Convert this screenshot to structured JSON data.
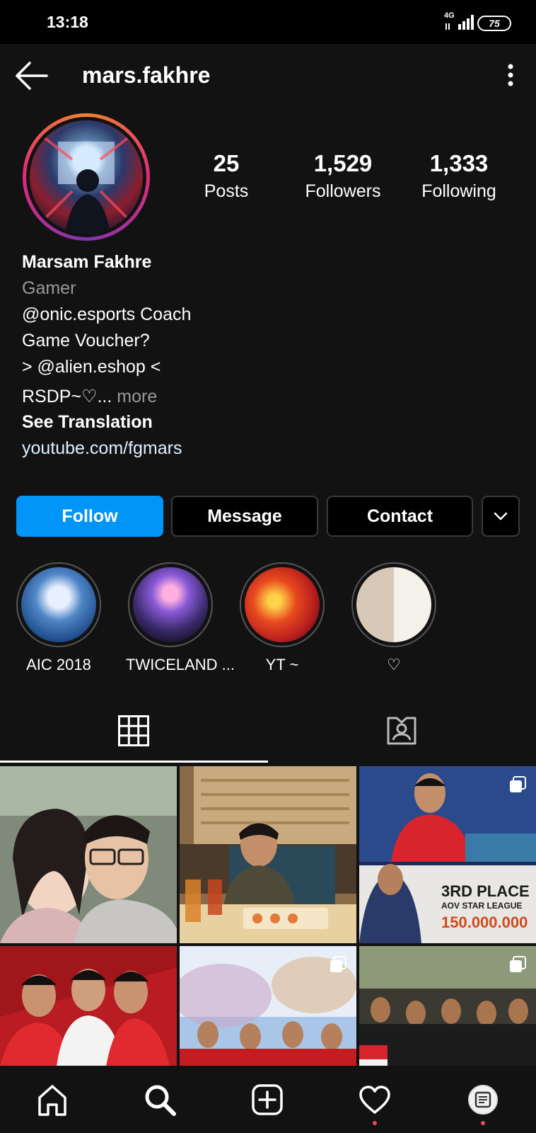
{
  "status_bar": {
    "time": "13:18",
    "network": "4G",
    "battery": "75"
  },
  "header": {
    "username": "mars.fakhre"
  },
  "stats": [
    {
      "value": "25",
      "label": "Posts"
    },
    {
      "value": "1,529",
      "label": "Followers"
    },
    {
      "value": "1,333",
      "label": "Following"
    }
  ],
  "bio": {
    "name": "Marsam Fakhre",
    "category": "Gamer",
    "lines": [
      "@onic.esports Coach",
      "Game Voucher?",
      "> @alien.eshop <",
      "RSDP~♡..."
    ],
    "more": " more",
    "see_translation": "See Translation",
    "link": "youtube.com/fgmars"
  },
  "actions": {
    "follow": "Follow",
    "message": "Message",
    "contact": "Contact"
  },
  "highlights": [
    {
      "label": "AIC 2018",
      "color": "#1e4a8a"
    },
    {
      "label": "TWICELAND ...",
      "color": "#5a2a8a"
    },
    {
      "label": "YT ~",
      "color": "#b81e1e"
    },
    {
      "label": "♡",
      "color": "#6a8ab8"
    }
  ],
  "grid_posts": [
    {
      "caption": "",
      "multi": false
    },
    {
      "caption": "",
      "multi": false
    },
    {
      "caption": "",
      "multi": true,
      "overlay": {
        "line1": "3RD PLACE",
        "line2": "AOV STAR LEAGUE",
        "line3": "150.000.000"
      }
    },
    {
      "caption": "",
      "multi": false
    },
    {
      "caption": "",
      "multi": true
    },
    {
      "caption": "",
      "multi": true
    }
  ],
  "colors": {
    "accent": "#0095f6",
    "background": "#121212",
    "notification": "#ed4956"
  }
}
